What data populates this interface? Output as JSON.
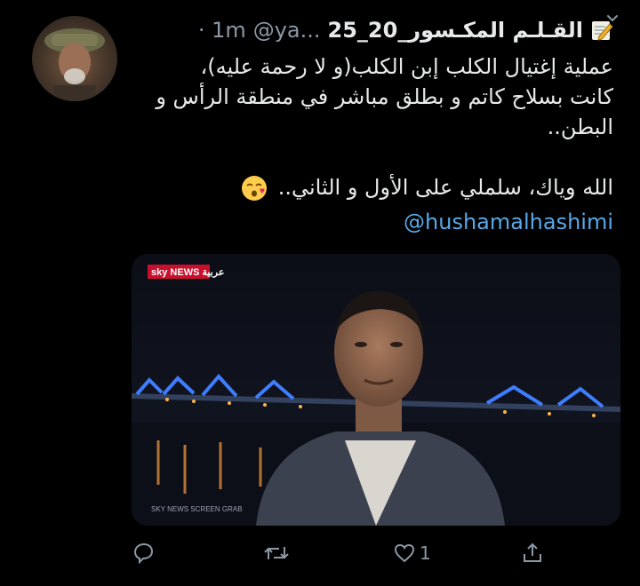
{
  "tweet": {
    "display_name": "25_القـلـم المكـسور_20",
    "handle": "@ya...",
    "time": "· 1m",
    "text_lines": [
      "عملية إغتيال الكلب إبن الكلب(و لا رحمة عليه)،",
      "كانت بسلاح كاتم و بطلق مباشر في منطقة الرأس و",
      "البطن.."
    ],
    "text_line2": "الله وياك، سلملي على الأول و الثاني..",
    "mention": "@hushamalhashimi",
    "media": {
      "channel_logo": "sky NEWS عربية",
      "watermark": "SKY NEWS SCREEN GRAB"
    },
    "actions": {
      "reply_icon": "reply-icon",
      "retweet_icon": "retweet-icon",
      "like_icon": "heart-icon",
      "like_count": "1",
      "share_icon": "share-icon"
    }
  },
  "colors": {
    "background": "#000000",
    "text": "#e7e9ea",
    "muted": "#8b98a5",
    "link": "#5aa7e8"
  }
}
